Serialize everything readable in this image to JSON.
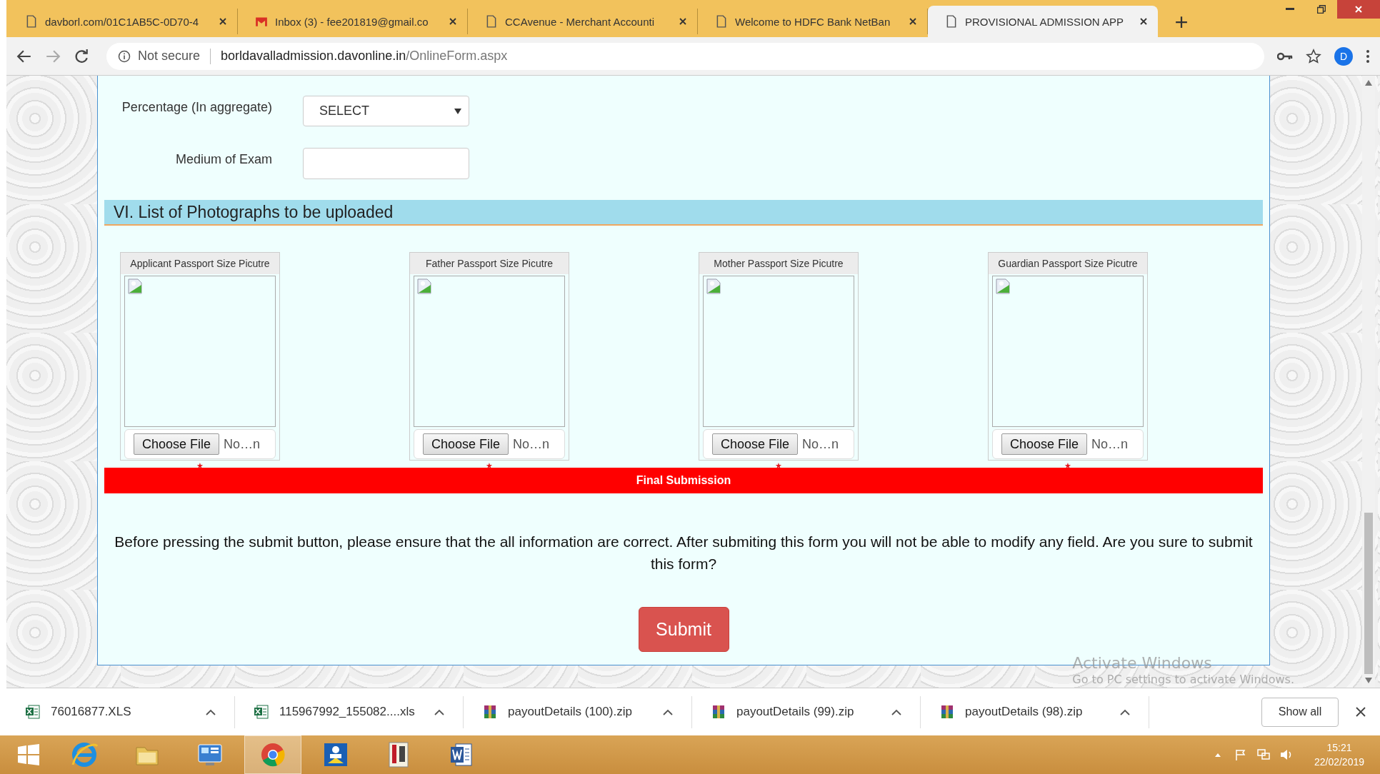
{
  "browser": {
    "tabs": [
      {
        "title": "davborl.com/01C1AB5C-0D70-4",
        "kind": "page",
        "selected": false
      },
      {
        "title": "Inbox (3) - fee201819@gmail.co",
        "kind": "mail",
        "selected": false
      },
      {
        "title": "CCAvenue - Merchant Accounti",
        "kind": "page",
        "selected": false
      },
      {
        "title": "Welcome to HDFC Bank NetBan",
        "kind": "page",
        "selected": false
      },
      {
        "title": "PROVISIONAL ADMISSION APP",
        "kind": "page",
        "selected": true
      }
    ],
    "address": {
      "security": "Not secure",
      "host": "borldavalladmission.davonline.in",
      "path": "/OnlineForm.aspx"
    },
    "profile_initial": "D"
  },
  "form": {
    "fields": [
      {
        "label": "Percentage (In aggregate)",
        "kind": "select",
        "value": "SELECT"
      },
      {
        "label": "Medium of Exam",
        "kind": "text"
      }
    ],
    "section_title": "VI. List of Photographs to be uploaded",
    "photos": [
      {
        "caption": "Applicant Passport Size Picutre",
        "button": "Choose File",
        "file_status": "No…n",
        "required_mark": "★"
      },
      {
        "caption": "Father Passport Size Picutre",
        "button": "Choose File",
        "file_status": "No…n",
        "required_mark": "★"
      },
      {
        "caption": "Mother Passport Size Picutre",
        "button": "Choose File",
        "file_status": "No…n",
        "required_mark": "★"
      },
      {
        "caption": "Guardian Passport Size Picutre",
        "button": "Choose File",
        "file_status": "No…n",
        "required_mark": "★"
      }
    ],
    "final_bar": "Final Submission",
    "notice": "Before pressing the submit button, please ensure that the all information are correct. After submiting this form you will not be able to modify any field. Are you sure to submit this form?",
    "submit": "Submit"
  },
  "activation_notice": {
    "title": "Activate Windows",
    "subtitle": "Go to PC settings to activate Windows."
  },
  "downloads": {
    "items": [
      {
        "name": "76016877.XLS",
        "kind": "spreadsheet"
      },
      {
        "name": "115967992_155082....xls",
        "kind": "spreadsheet"
      },
      {
        "name": "payoutDetails (100).zip",
        "kind": "archive"
      },
      {
        "name": "payoutDetails (99).zip",
        "kind": "archive"
      },
      {
        "name": "payoutDetails (98).zip",
        "kind": "archive"
      }
    ],
    "show_all": "Show all"
  },
  "taskbar": {
    "apps": [
      {
        "kind": "browser-e",
        "selected": false
      },
      {
        "kind": "folder",
        "selected": false
      },
      {
        "kind": "panel",
        "selected": false
      },
      {
        "kind": "chrome",
        "selected": true
      },
      {
        "kind": "reader",
        "selected": false
      },
      {
        "kind": "ledger",
        "selected": false
      },
      {
        "kind": "document",
        "selected": false
      }
    ],
    "clock": {
      "time": "15:21",
      "date": "22/02/2019"
    }
  }
}
